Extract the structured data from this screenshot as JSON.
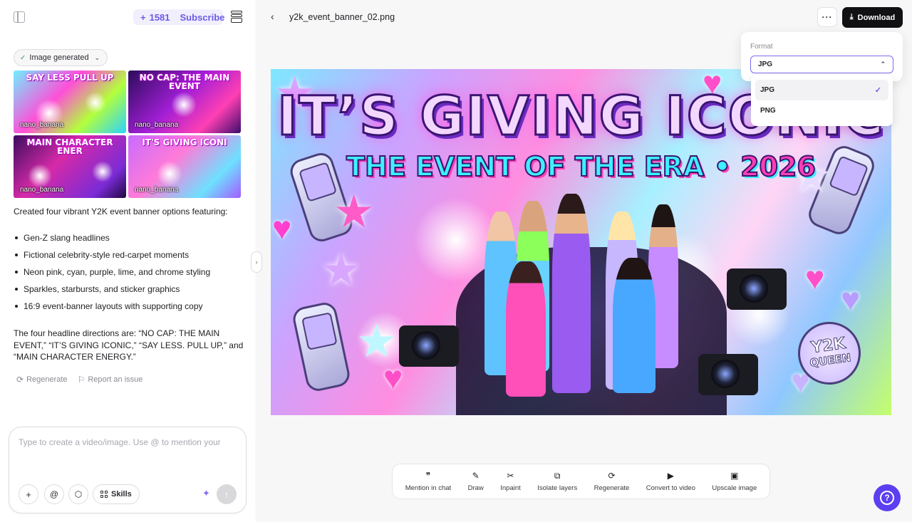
{
  "header": {
    "credits": "1581",
    "subscribe_label": "Subscribe"
  },
  "chat": {
    "chip_label": "Image generated",
    "thumbnails": [
      {
        "title": "SAY LESS PULL UP",
        "tag": "nano_banana"
      },
      {
        "title": "NO CAP: THE MAIN EVENT",
        "tag": "nano_banana"
      },
      {
        "title": "MAIN CHARACTER ENER",
        "tag": "nano_banana"
      },
      {
        "title": "IT'S GIVING ICONI",
        "tag": "nano_banana"
      }
    ],
    "intro": "Created four vibrant Y2K event banner options featuring:",
    "bullets": [
      "Gen-Z slang headlines",
      "Fictional celebrity-style red-carpet moments",
      "Neon pink, cyan, purple, lime, and chrome styling",
      "Sparkles, starbursts, and sticker graphics",
      "16:9 event-banner layouts with supporting copy"
    ],
    "summary": "The four headline directions are: “NO CAP: THE MAIN EVENT,” “IT’S GIVING ICONIC,” “SAY LESS. PULL UP,” and “MAIN CHARACTER ENERGY.”",
    "actions": {
      "regenerate": "Regenerate",
      "report": "Report an issue"
    },
    "composer": {
      "placeholder": "Type to create a video/image. Use @ to mention your",
      "skills_label": "Skills"
    }
  },
  "viewer": {
    "filename": "y2k_event_banner_02.png",
    "download_label": "Download",
    "banner": {
      "headline": "IT’S GIVING ICONIC",
      "subhead": "THE EVENT OF THE ERA •",
      "year": "2026",
      "badge_line1": "Y2K",
      "badge_line2": "QUEEN"
    },
    "format": {
      "label": "Format",
      "selected": "JPG",
      "options": [
        "JPG",
        "PNG"
      ]
    },
    "toolbar": [
      {
        "label": "Mention in chat",
        "icon": "quote-icon"
      },
      {
        "label": "Draw",
        "icon": "brush-icon"
      },
      {
        "label": "Inpaint",
        "icon": "scissors-icon"
      },
      {
        "label": "Isolate layers",
        "icon": "layers-icon"
      },
      {
        "label": "Regenerate",
        "icon": "refresh-icon"
      },
      {
        "label": "Convert to video",
        "icon": "play-icon"
      },
      {
        "label": "Upscale image",
        "icon": "hd-icon"
      }
    ]
  },
  "colors": {
    "accent": "#6b5be6",
    "help_button": "#5b3ff0",
    "download_button": "#111114"
  }
}
